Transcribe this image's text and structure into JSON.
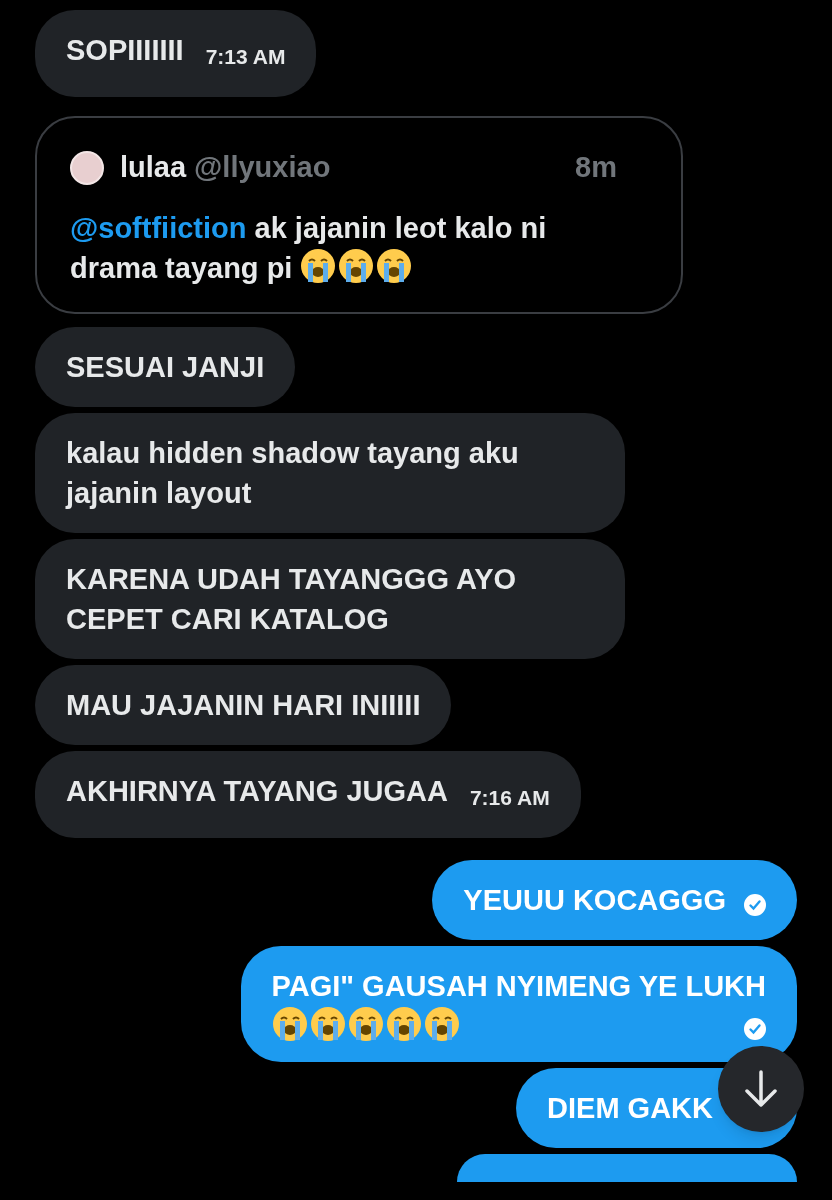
{
  "messages": [
    {
      "kind": "received",
      "text": "SOPIIIIIII",
      "time": "7:13 AM"
    },
    {
      "kind": "quote",
      "author": "lulaa",
      "handle": "@llyuxiao",
      "age": "8m",
      "mention": "@softfiiction",
      "text": "ak jajanin leot kalo ni drama tayang pi",
      "emojis": [
        {
          "kind": "crying"
        },
        {
          "kind": "crying"
        },
        {
          "kind": "crying"
        }
      ]
    },
    {
      "kind": "received",
      "text": "SESUAI JANJI"
    },
    {
      "kind": "received",
      "text": "kalau hidden shadow tayang aku jajanin layout"
    },
    {
      "kind": "received",
      "text": "KARENA UDAH TAYANGGG AYO CEPET CARI KATALOG"
    },
    {
      "kind": "received",
      "text": "MAU JAJANIN HARI INIIIII"
    },
    {
      "kind": "received",
      "text": "AKHIRNYA TAYANG JUGAA",
      "time": "7:16 AM"
    },
    {
      "kind": "sent",
      "text": "YEUUU KOCAGGG",
      "seen": true
    },
    {
      "kind": "sent",
      "text": "PAGI\" GAUSAH NYIMENG YE LUKH",
      "emojis": [
        {
          "kind": "crying"
        },
        {
          "kind": "crying"
        },
        {
          "kind": "crying"
        },
        {
          "kind": "crying"
        },
        {
          "kind": "crying"
        }
      ],
      "seen": true
    },
    {
      "kind": "sent",
      "text": "DIEM GAKK"
    },
    {
      "kind": "partial"
    }
  ]
}
